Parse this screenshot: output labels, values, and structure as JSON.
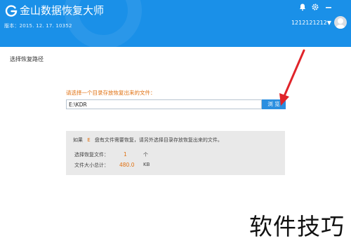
{
  "app": {
    "title": "金山数据恢复大师",
    "version": "版本：2015. 12. 17. 10352",
    "username": "1212121212▼"
  },
  "icons": {
    "logo": "g-logo-icon",
    "notification": "bell-icon",
    "settings": "gear-icon",
    "minimize": "minimize-icon",
    "avatar": "user-avatar-icon"
  },
  "colors": {
    "titlebar": "#1a90e8",
    "accent_orange": "#e07010",
    "browse_button": "#2b8fe0",
    "arrow": "#e0242a"
  },
  "main": {
    "section_title": "选择恢复路径",
    "prompt": "请选择一个目录存放恢复出来的文件：",
    "path_value": "E:\\KDR",
    "browse_label": "浏  览"
  },
  "info": {
    "line1_prefix": "如果",
    "line1_drive": "E",
    "line1_suffix": "盘有文件需要恢复，请另外选择目录存放恢复出来的文件。",
    "files_label": "选择恢复文件：",
    "files_value": "1",
    "files_unit": "个",
    "size_label": "文件大小总计：",
    "size_value": "480.0",
    "size_unit": "KB"
  },
  "watermark": "软件技巧"
}
